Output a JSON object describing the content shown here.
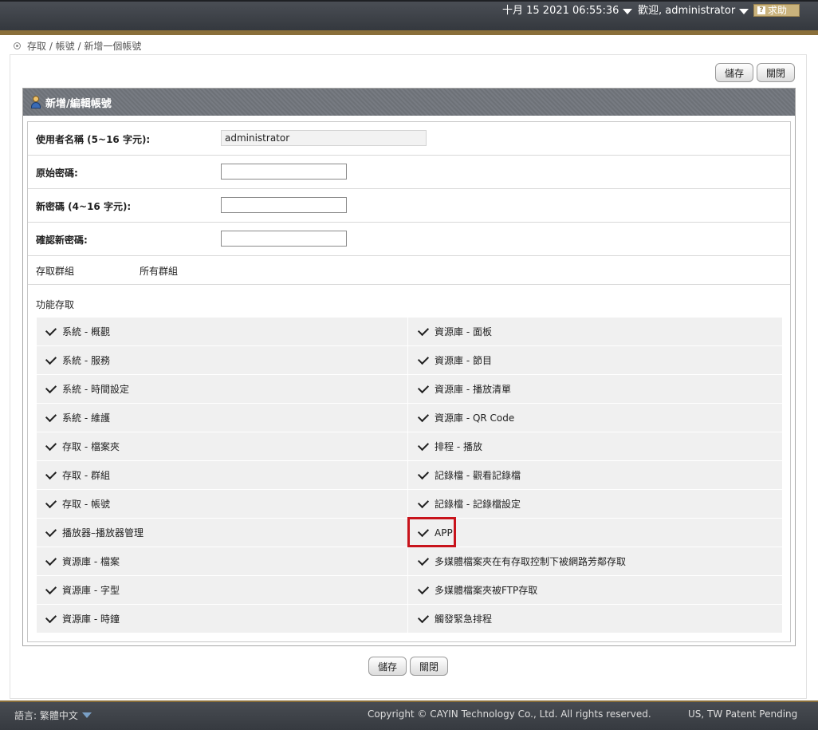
{
  "topbar": {
    "datetime": "十月 15 2021 06:55:36",
    "welcome": "歡迎, administrator",
    "help_label": "求助"
  },
  "breadcrumb": {
    "items": [
      "存取",
      "帳號",
      "新增一個帳號"
    ],
    "text": "存取 / 帳號 / 新增一個帳號"
  },
  "toolbar": {
    "save_label": "儲存",
    "close_label": "關閉"
  },
  "dialog": {
    "title": "新增/編輯帳號",
    "fields": {
      "username_label": "使用者名稱 (5~16 字元):",
      "username_value": "administrator",
      "orig_password_label": "原始密碼:",
      "new_password_label": "新密碼 (4~16 字元):",
      "confirm_password_label": "確認新密碼:",
      "access_group_label": "存取群組",
      "access_group_value": "所有群組",
      "function_access_label": "功能存取"
    },
    "functions": [
      {
        "left": "系統 - 概觀",
        "right": "資源庫 - 面板"
      },
      {
        "left": "系統 - 服務",
        "right": "資源庫 - 節目"
      },
      {
        "left": "系統 - 時間設定",
        "right": "資源庫 - 播放清單"
      },
      {
        "left": "系統 - 維護",
        "right": "資源庫 - QR Code"
      },
      {
        "left": "存取 - 檔案夾",
        "right": "排程 - 播放"
      },
      {
        "left": "存取 - 群組",
        "right": "記錄檔 - 觀看記錄檔"
      },
      {
        "left": "存取 - 帳號",
        "right": "記錄檔 - 記錄檔設定"
      },
      {
        "left": "播放器–播放器管理",
        "right": "APP"
      },
      {
        "left": "資源庫 - 檔案",
        "right": "多媒體檔案夾在有存取控制下被網路芳鄰存取"
      },
      {
        "left": "資源庫 - 字型",
        "right": "多媒體檔案夾被FTP存取"
      },
      {
        "left": "資源庫 - 時鐘",
        "right": "觸發緊急排程"
      }
    ]
  },
  "footer": {
    "language": "語言: 繁體中文",
    "copyright": "Copyright © CAYIN Technology Co., Ltd. All rights reserved.",
    "patent": "US, TW Patent Pending"
  },
  "colors": {
    "topbar": "#3e4248",
    "accent": "#8a6f3a",
    "header": "#717379",
    "highlight": "#c8131b"
  }
}
